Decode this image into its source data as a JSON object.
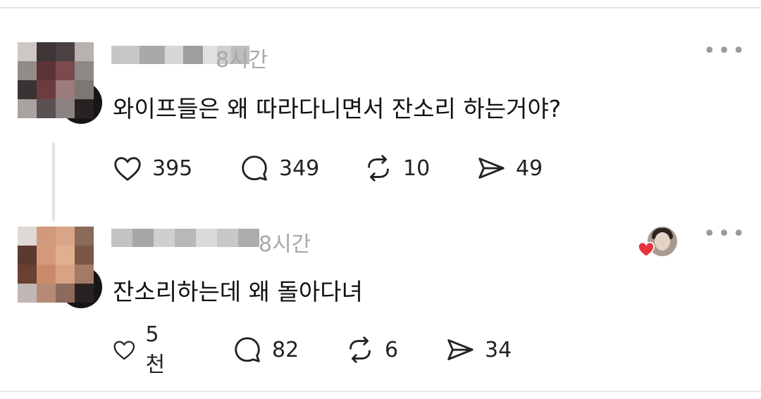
{
  "posts": [
    {
      "time": "8시간",
      "text": "와이프들은 왜 따라다니면서 잔소리 하는거야?",
      "likes": "395",
      "replies": "349",
      "reposts": "10",
      "shares": "49",
      "more": "•••"
    },
    {
      "time": "8시간",
      "text": "잔소리하는데 왜 돌아다녀",
      "likes": "5천",
      "replies": "82",
      "reposts": "6",
      "shares": "34",
      "more": "•••"
    }
  ],
  "icons": {
    "like": "heart-icon",
    "reply": "comment-icon",
    "repost": "repost-icon",
    "share": "send-icon",
    "more": "more-icon",
    "liked_badge": "heart-badge-icon"
  },
  "colors": {
    "heart_badge": "#e8333f",
    "time_text": "#a8a8a8",
    "icon_stroke": "#222222"
  }
}
